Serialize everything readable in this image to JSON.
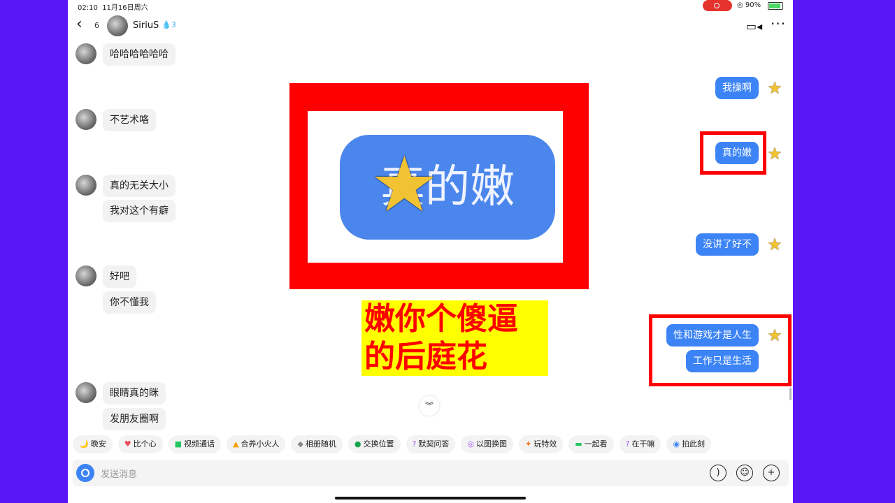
{
  "status": {
    "time": "02:10",
    "date": "11月16日周六",
    "battery": "90%"
  },
  "header": {
    "unread_count": "6",
    "nickname": "SiriuS",
    "streak": "3"
  },
  "left_messages": [
    "哈哈哈哈哈哈",
    "不艺术咯",
    "真的无关大小",
    "我对这个有癖",
    "好吧",
    "你不懂我",
    "眼睛真的眯",
    "发朋友圈啊"
  ],
  "right_messages": [
    "我操啊",
    "真的嫩",
    "没讲了好不",
    "性和游戏才是人生",
    "工作只是生活"
  ],
  "zoom_text": "真的嫩",
  "caption": {
    "line1": "嫩你个傻逼",
    "line2": "的后庭花"
  },
  "quick_actions": [
    {
      "label": "晚安",
      "icon": "🌙",
      "color": "#6b7bd8"
    },
    {
      "label": "比个心",
      "icon": "♥",
      "color": "#f0475c"
    },
    {
      "label": "视频通话",
      "icon": "■",
      "color": "#22c55e"
    },
    {
      "label": "合养小火人",
      "icon": "▲",
      "color": "#f59e0b"
    },
    {
      "label": "相册随机",
      "icon": "◆",
      "color": "#888888"
    },
    {
      "label": "交换位置",
      "icon": "●",
      "color": "#16a34a"
    },
    {
      "label": "默契问答",
      "icon": "?",
      "color": "#a855f7"
    },
    {
      "label": "以图换图",
      "icon": "◎",
      "color": "#a855f7"
    },
    {
      "label": "玩特效",
      "icon": "✦",
      "color": "#f97316"
    },
    {
      "label": "一起看",
      "icon": "▬",
      "color": "#22c55e"
    },
    {
      "label": "在干嘛",
      "icon": "?",
      "color": "#a855f7"
    },
    {
      "label": "拍此刻",
      "icon": "◉",
      "color": "#3b82f6"
    }
  ],
  "input": {
    "placeholder": "发送消息"
  },
  "icons": {
    "voice": "voice-icon",
    "emoji": "emoji-icon",
    "plus": "plus-icon",
    "video": "video-call-icon",
    "more": "more-icon"
  }
}
